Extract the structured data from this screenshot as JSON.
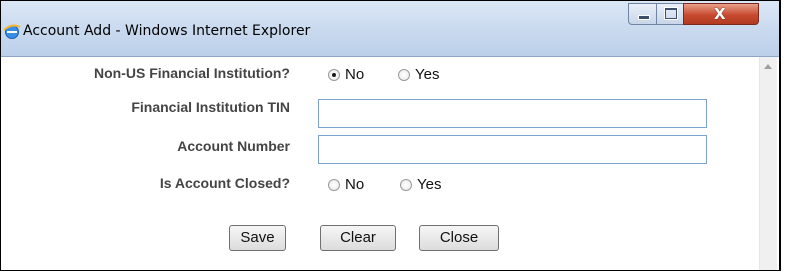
{
  "window": {
    "title": "Account Add - Windows Internet Explorer",
    "controls": {
      "minimize_icon": "minimize-icon",
      "maximize_icon": "maximize-icon",
      "close_glyph": "X"
    }
  },
  "form": {
    "non_us_fi": {
      "label": "Non-US Financial Institution?",
      "options": [
        {
          "label": "No",
          "selected": true
        },
        {
          "label": "Yes",
          "selected": false
        }
      ]
    },
    "fi_tin": {
      "label": "Financial Institution TIN",
      "value": ""
    },
    "account_number": {
      "label": "Account Number",
      "value": ""
    },
    "is_account_closed": {
      "label": "Is Account Closed?",
      "options": [
        {
          "label": "No",
          "selected": false
        },
        {
          "label": "Yes",
          "selected": false
        }
      ]
    },
    "buttons": {
      "save": "Save",
      "clear": "Clear",
      "close": "Close"
    }
  }
}
